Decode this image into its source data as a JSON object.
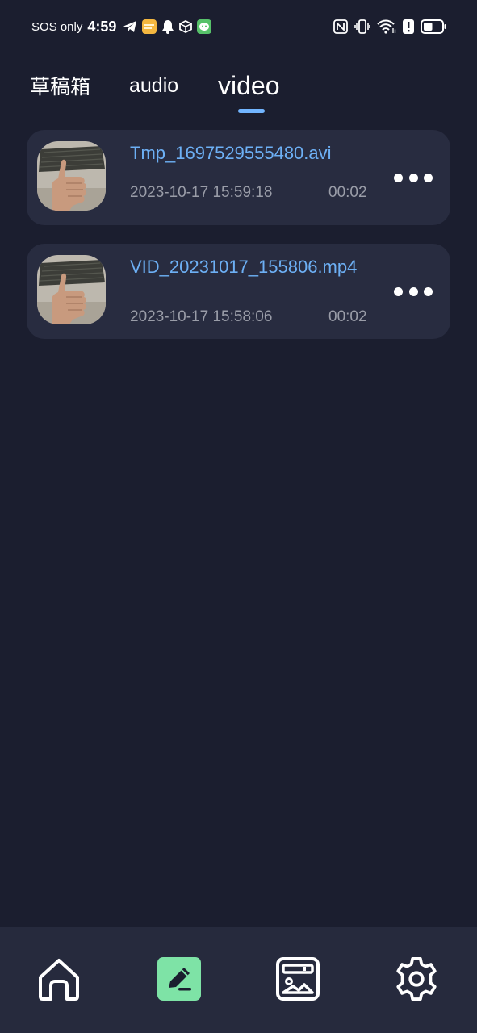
{
  "status_bar": {
    "carrier": "SOS only",
    "time": "4:59",
    "left_icons": [
      "telegram-icon",
      "notes-app-icon",
      "bell-icon",
      "box-icon",
      "wechat-icon"
    ],
    "right_icons": [
      "nfc-icon",
      "vibrate-icon",
      "wifi-icon",
      "alert-icon",
      "battery-icon"
    ],
    "battery_level": 0.5
  },
  "tabs": [
    {
      "label": "草稿箱",
      "active": false
    },
    {
      "label": "audio",
      "active": false
    },
    {
      "label": "video",
      "active": true
    }
  ],
  "files": [
    {
      "name": "Tmp_1697529555480.avi",
      "date": "2023-10-17 15:59:18",
      "duration": "00:02",
      "thumb_icon": "video-thumbnail"
    },
    {
      "name": "VID_20231017_155806.mp4",
      "date": "2023-10-17 15:58:06",
      "duration": "00:02",
      "thumb_icon": "video-thumbnail"
    }
  ],
  "bottom_nav": [
    {
      "icon": "home-icon",
      "active": false
    },
    {
      "icon": "edit-icon",
      "active": true
    },
    {
      "icon": "gallery-icon",
      "active": false
    },
    {
      "icon": "gear-icon",
      "active": false
    }
  ],
  "colors": {
    "background": "#1b1e2f",
    "card": "#282c40",
    "accent_blue": "#6db0f5",
    "active_nav": "#7ee3a6",
    "muted_text": "#9a9da8"
  }
}
